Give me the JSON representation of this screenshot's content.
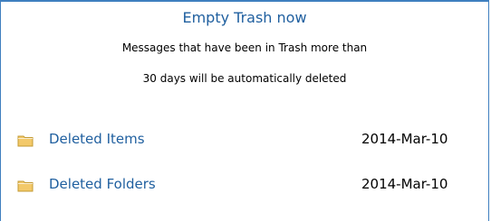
{
  "trash": {
    "empty_label": "Empty Trash now",
    "notice_line1": "Messages that have been in Trash more than",
    "notice_line2": "30 days will be automatically deleted"
  },
  "folders": [
    {
      "label": "Deleted Items",
      "date": "2014-Mar-10",
      "icon": "folder-icon"
    },
    {
      "label": "Deleted Folders",
      "date": "2014-Mar-10",
      "icon": "folder-icon"
    }
  ],
  "colors": {
    "accent": "#3f7fbf",
    "link": "#1f5f9f",
    "folder_fill": "#f3c96a",
    "folder_stroke": "#c39a33"
  }
}
